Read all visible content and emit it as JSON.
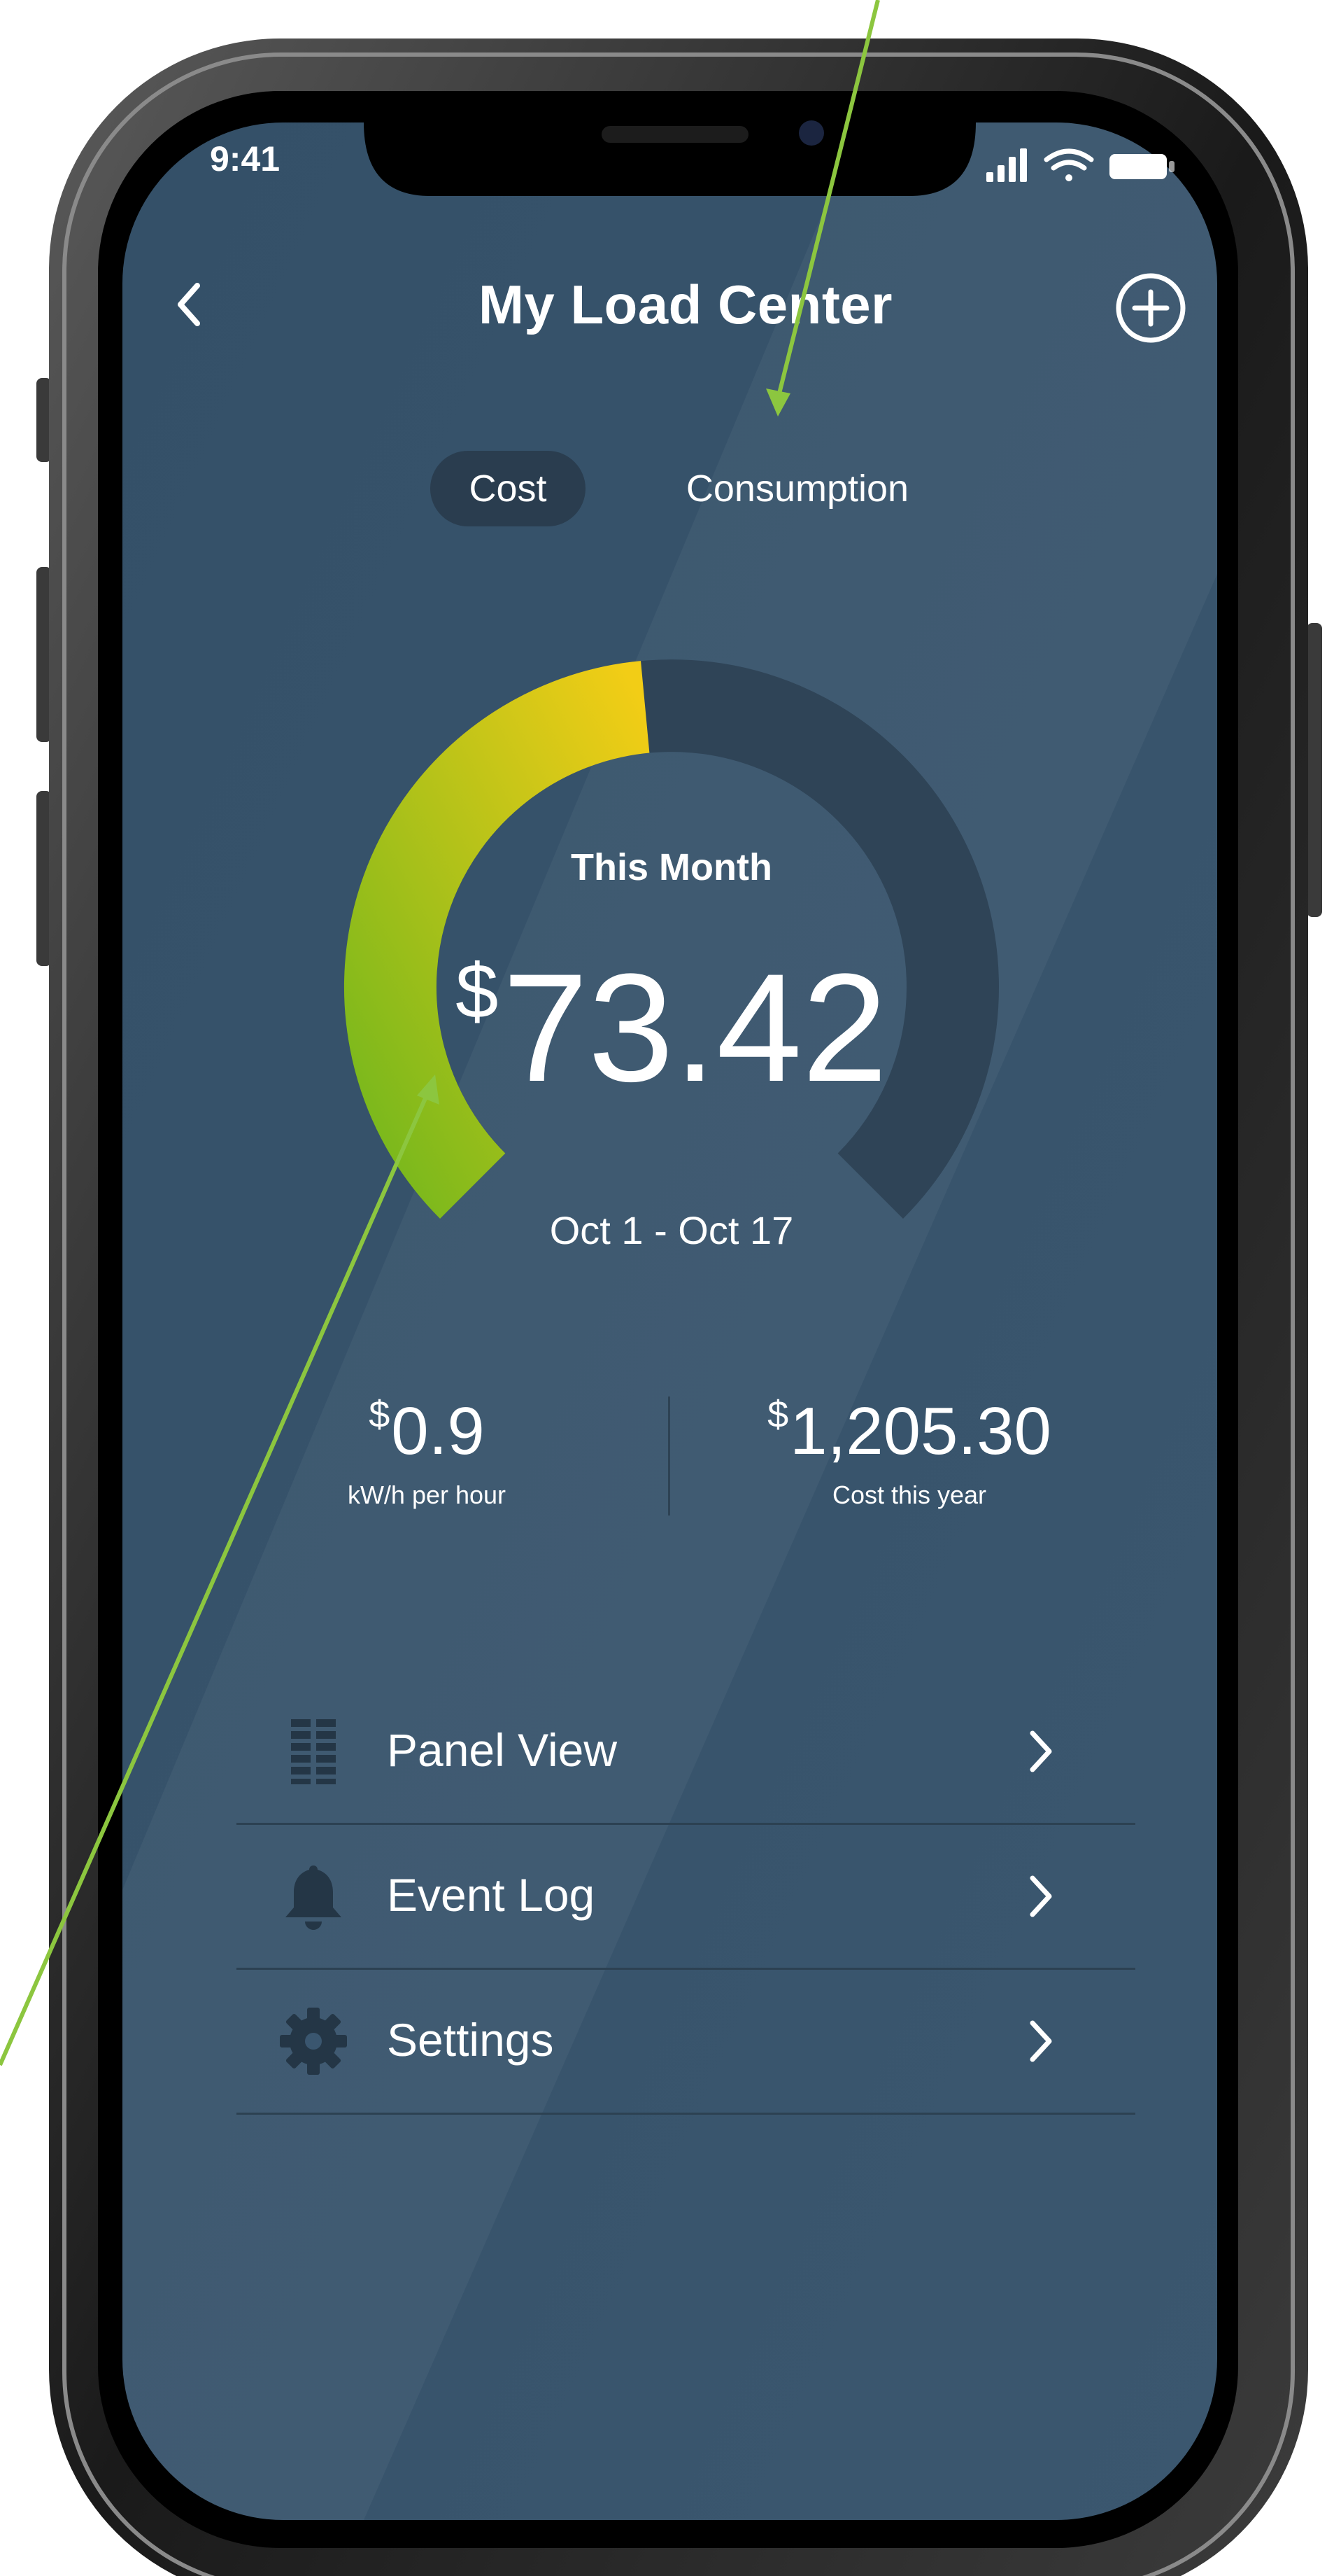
{
  "status_bar": {
    "time": "9:41"
  },
  "header": {
    "title": "My Load Center"
  },
  "tabs": [
    {
      "label": "Cost",
      "selected": true
    },
    {
      "label": "Consumption",
      "selected": false
    }
  ],
  "gauge": {
    "fill_percent": 48,
    "period_label": "This Month",
    "currency_symbol": "$",
    "amount": "73.42",
    "date_range": "Oct 1 - Oct 17"
  },
  "stats": {
    "left": {
      "currency_symbol": "$",
      "value": "0.9",
      "label": "kW/h per hour"
    },
    "right": {
      "currency_symbol": "$",
      "value": "1,205.30",
      "label": "Cost this year"
    }
  },
  "menu": [
    {
      "label": "Panel View",
      "icon": "panel-grid-icon"
    },
    {
      "label": "Event Log",
      "icon": "bell-icon"
    },
    {
      "label": "Settings",
      "icon": "gear-icon"
    }
  ],
  "colors": {
    "screen_background": "#3a566f",
    "gauge_track": "#2f4457",
    "gauge_fill_start": "#78b81c",
    "gauge_fill_end": "#f2cd16",
    "annotation_arrow": "#8cc63f"
  }
}
